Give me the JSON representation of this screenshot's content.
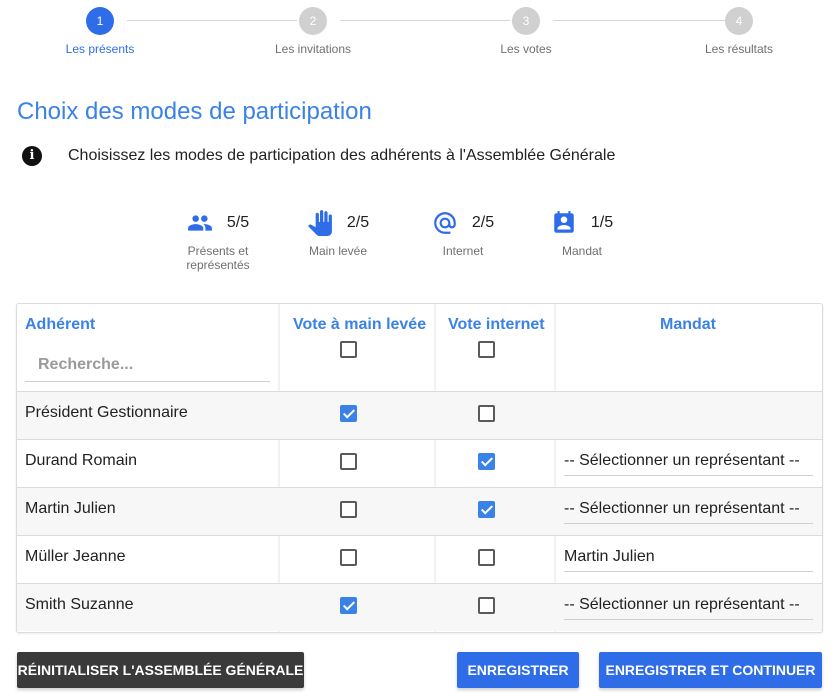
{
  "stepper": {
    "steps": [
      {
        "num": "1",
        "label": "Les présents"
      },
      {
        "num": "2",
        "label": "Les invitations"
      },
      {
        "num": "3",
        "label": "Les votes"
      },
      {
        "num": "4",
        "label": "Les résultats"
      }
    ],
    "active_step": 1
  },
  "page_title": "Choix des modes de participation",
  "info": {
    "icon": "info-icon",
    "text": "Choisissez les modes de participation des adhérents à l'Assemblée Générale"
  },
  "stats": [
    {
      "icon": "people-icon",
      "value": "5/5",
      "label_line1": "Présents et",
      "label_line2": "représentés"
    },
    {
      "icon": "hand-icon",
      "value": "2/5",
      "label_line1": "Main levée",
      "label_line2": ""
    },
    {
      "icon": "at-icon",
      "value": "2/5",
      "label_line1": "Internet",
      "label_line2": ""
    },
    {
      "icon": "contact-icon",
      "value": "1/5",
      "label_line1": "Mandat",
      "label_line2": ""
    }
  ],
  "table": {
    "headers": {
      "member": "Adhérent",
      "hand_vote": "Vote à main levée",
      "internet_vote": "Vote internet",
      "proxy": "Mandat"
    },
    "search_placeholder": "Recherche...",
    "rows": [
      {
        "name": "Président Gestionnaire",
        "hand": true,
        "internet": false,
        "proxy": ""
      },
      {
        "name": "Durand Romain",
        "hand": false,
        "internet": true,
        "proxy": "-- Sélectionner un représentant --"
      },
      {
        "name": "Martin Julien",
        "hand": false,
        "internet": true,
        "proxy": "-- Sélectionner un représentant --"
      },
      {
        "name": "Müller Jeanne",
        "hand": false,
        "internet": false,
        "proxy": "Martin Julien"
      },
      {
        "name": "Smith Suzanne",
        "hand": true,
        "internet": false,
        "proxy": "-- Sélectionner un représentant --"
      }
    ]
  },
  "buttons": {
    "reset": "RÉINITIALISER L'ASSEMBLÉE GÉNÉRALE",
    "save": "ENREGISTRER",
    "save_continue": "ENREGISTRER ET CONTINUER"
  },
  "colors": {
    "accent": "#2f6de8",
    "title": "#3b82e8",
    "dark_button": "#3a3a3a"
  }
}
